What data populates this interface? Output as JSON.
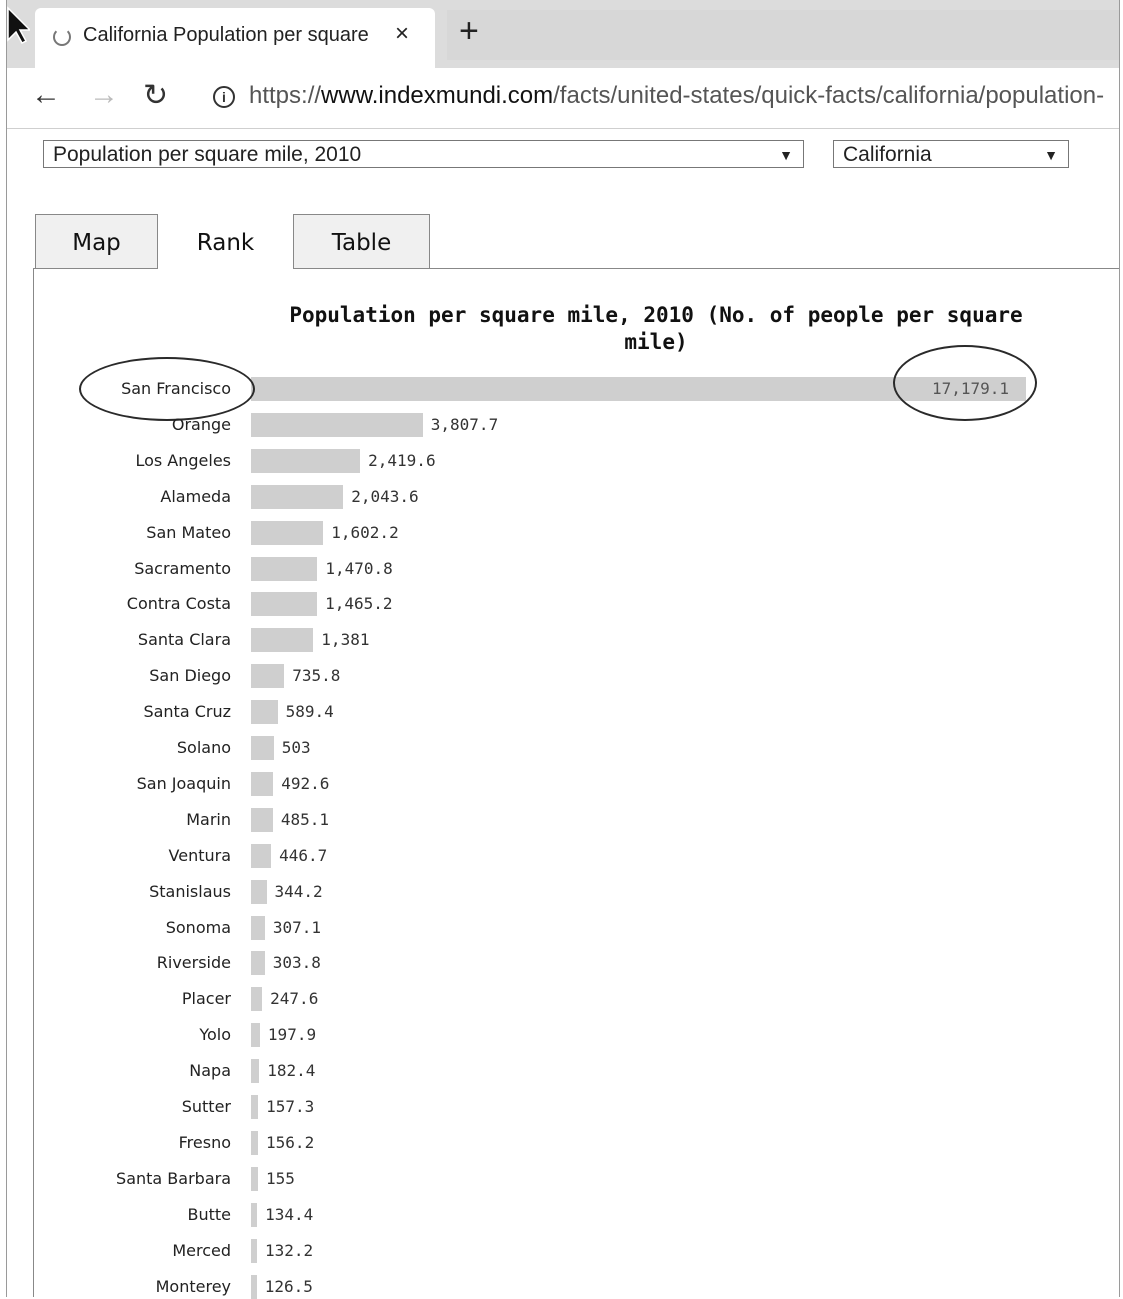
{
  "browser": {
    "tab_title": "California Population per square mile",
    "tab_close": "×",
    "new_tab": "+",
    "address": {
      "scheme": "https://",
      "host": "www.indexmundi.com",
      "path": "/facts/united-states/quick-facts/california/population-"
    }
  },
  "filters": {
    "metric_selected": "Population per square mile, 2010",
    "region_selected": "California"
  },
  "view_tabs": [
    {
      "label": "Map"
    },
    {
      "label": "Rank"
    },
    {
      "label": "Table"
    }
  ],
  "active_tab": "Rank",
  "chart_data": {
    "type": "bar",
    "orientation": "horizontal",
    "title": "Population per square mile, 2010 (No. of people per square mile)",
    "xlim": [
      0,
      17179.1
    ],
    "bar_color": "#cfcfcf",
    "highlighted": "San Francisco",
    "categories": [
      "San Francisco",
      "Orange",
      "Los Angeles",
      "Alameda",
      "San Mateo",
      "Sacramento",
      "Contra Costa",
      "Santa Clara",
      "San Diego",
      "Santa Cruz",
      "Solano",
      "San Joaquin",
      "Marin",
      "Ventura",
      "Stanislaus",
      "Sonoma",
      "Riverside",
      "Placer",
      "Yolo",
      "Napa",
      "Sutter",
      "Fresno",
      "Santa Barbara",
      "Butte",
      "Merced",
      "Monterey"
    ],
    "values": [
      17179.1,
      3807.7,
      2419.6,
      2043.6,
      1602.2,
      1470.8,
      1465.2,
      1381,
      735.8,
      589.4,
      503,
      492.6,
      485.1,
      446.7,
      344.2,
      307.1,
      303.8,
      247.6,
      197.9,
      182.4,
      157.3,
      156.2,
      155,
      134.4,
      132.2,
      126.5
    ],
    "value_labels": [
      "17,179.1",
      "3,807.7",
      "2,419.6",
      "2,043.6",
      "1,602.2",
      "1,470.8",
      "1,465.2",
      "1,381",
      "735.8",
      "589.4",
      "503",
      "492.6",
      "485.1",
      "446.7",
      "344.2",
      "307.1",
      "303.8",
      "247.6",
      "197.9",
      "182.4",
      "157.3",
      "156.2",
      "155",
      "134.4",
      "132.2",
      "126.5"
    ]
  }
}
